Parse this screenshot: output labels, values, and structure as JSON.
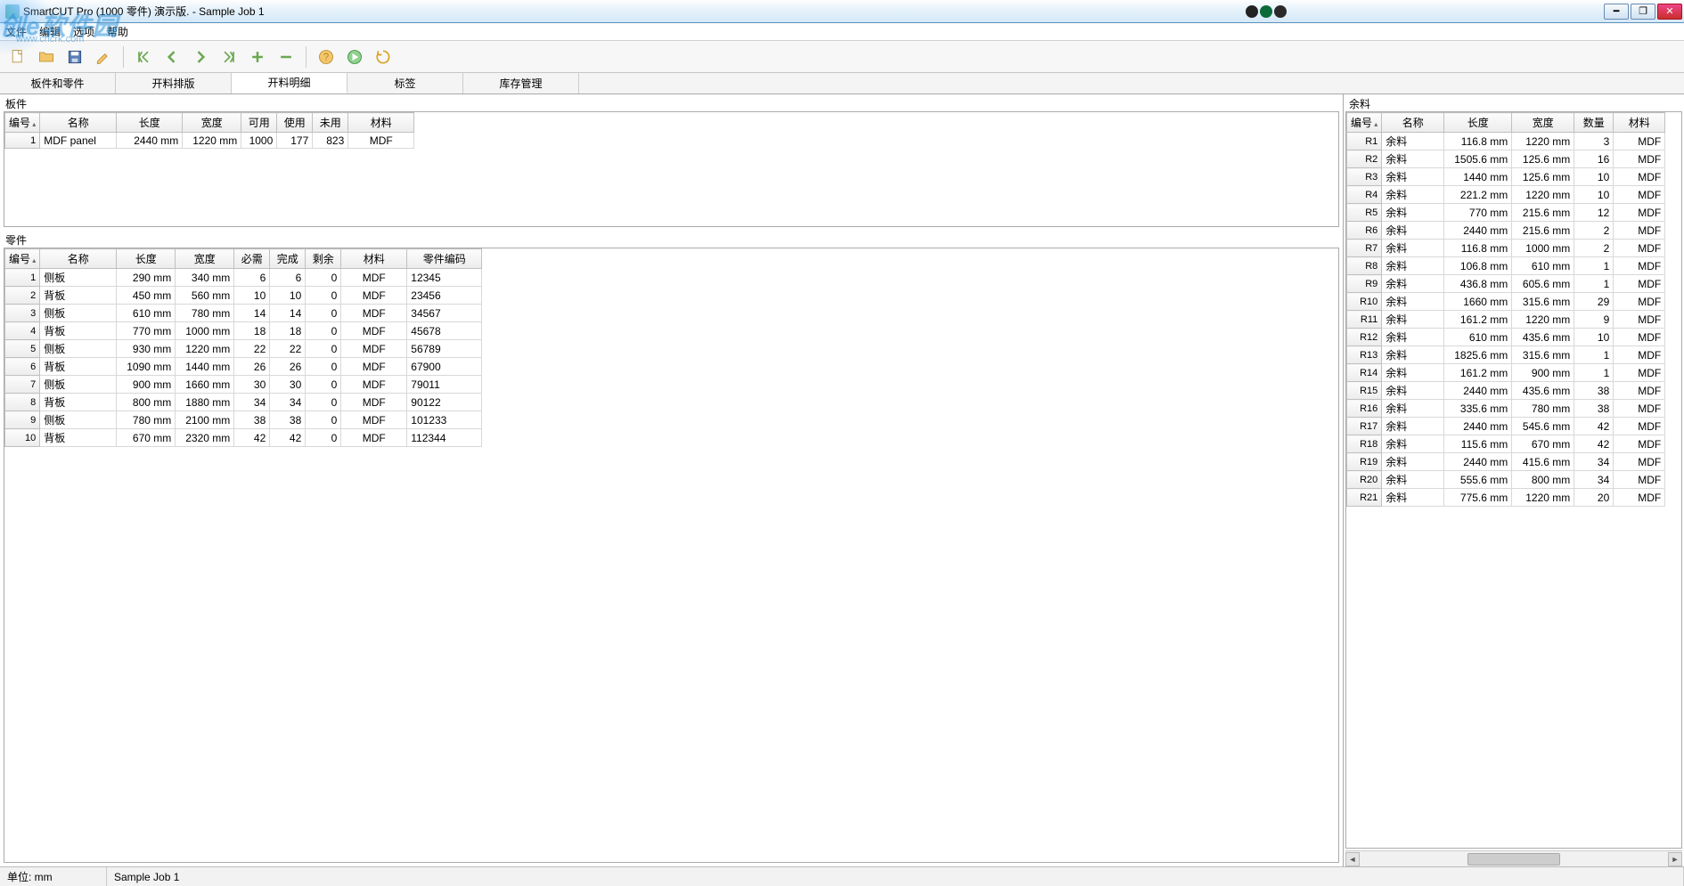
{
  "window": {
    "title": "SmartCUT Pro (1000 零件) 演示版. - Sample Job 1"
  },
  "menu": {
    "file": "文件",
    "edit": "编辑",
    "options": "选项",
    "help": "帮助"
  },
  "tabs": {
    "t0": "板件和零件",
    "t1": "开料排版",
    "t2": "开料明细",
    "t3": "标签",
    "t4": "库存管理"
  },
  "sections": {
    "panels": "板件",
    "parts": "零件",
    "offcuts": "余料"
  },
  "panels_headers": {
    "id": "编号",
    "name": "名称",
    "length": "长度",
    "width": "宽度",
    "avail": "可用",
    "used": "使用",
    "unused": "未用",
    "material": "材料"
  },
  "panels_rows": [
    {
      "id": "1",
      "name": "MDF panel",
      "length": "2440 mm",
      "width": "1220 mm",
      "avail": "1000",
      "used": "177",
      "unused": "823",
      "material": "MDF"
    }
  ],
  "parts_headers": {
    "id": "编号",
    "name": "名称",
    "length": "长度",
    "width": "宽度",
    "need": "必需",
    "done": "完成",
    "remain": "剩余",
    "material": "材料",
    "code": "零件编码"
  },
  "parts_rows": [
    {
      "id": "1",
      "name": "侧板",
      "length": "290 mm",
      "width": "340 mm",
      "need": "6",
      "done": "6",
      "remain": "0",
      "material": "MDF",
      "code": "12345"
    },
    {
      "id": "2",
      "name": "背板",
      "length": "450 mm",
      "width": "560 mm",
      "need": "10",
      "done": "10",
      "remain": "0",
      "material": "MDF",
      "code": "23456"
    },
    {
      "id": "3",
      "name": "侧板",
      "length": "610 mm",
      "width": "780 mm",
      "need": "14",
      "done": "14",
      "remain": "0",
      "material": "MDF",
      "code": "34567"
    },
    {
      "id": "4",
      "name": "背板",
      "length": "770 mm",
      "width": "1000 mm",
      "need": "18",
      "done": "18",
      "remain": "0",
      "material": "MDF",
      "code": "45678"
    },
    {
      "id": "5",
      "name": "侧板",
      "length": "930 mm",
      "width": "1220 mm",
      "need": "22",
      "done": "22",
      "remain": "0",
      "material": "MDF",
      "code": "56789"
    },
    {
      "id": "6",
      "name": "背板",
      "length": "1090 mm",
      "width": "1440 mm",
      "need": "26",
      "done": "26",
      "remain": "0",
      "material": "MDF",
      "code": "67900"
    },
    {
      "id": "7",
      "name": "侧板",
      "length": "900 mm",
      "width": "1660 mm",
      "need": "30",
      "done": "30",
      "remain": "0",
      "material": "MDF",
      "code": "79011"
    },
    {
      "id": "8",
      "name": "背板",
      "length": "800 mm",
      "width": "1880 mm",
      "need": "34",
      "done": "34",
      "remain": "0",
      "material": "MDF",
      "code": "90122"
    },
    {
      "id": "9",
      "name": "侧板",
      "length": "780 mm",
      "width": "2100 mm",
      "need": "38",
      "done": "38",
      "remain": "0",
      "material": "MDF",
      "code": "101233"
    },
    {
      "id": "10",
      "name": "背板",
      "length": "670 mm",
      "width": "2320 mm",
      "need": "42",
      "done": "42",
      "remain": "0",
      "material": "MDF",
      "code": "112344"
    }
  ],
  "offcuts_headers": {
    "id": "编号",
    "name": "名称",
    "length": "长度",
    "width": "宽度",
    "qty": "数量",
    "material": "材料"
  },
  "offcuts_rows": [
    {
      "id": "R1",
      "name": "余料",
      "length": "116.8 mm",
      "width": "1220 mm",
      "qty": "3",
      "material": "MDF"
    },
    {
      "id": "R2",
      "name": "余料",
      "length": "1505.6 mm",
      "width": "125.6 mm",
      "qty": "16",
      "material": "MDF"
    },
    {
      "id": "R3",
      "name": "余料",
      "length": "1440 mm",
      "width": "125.6 mm",
      "qty": "10",
      "material": "MDF"
    },
    {
      "id": "R4",
      "name": "余料",
      "length": "221.2 mm",
      "width": "1220 mm",
      "qty": "10",
      "material": "MDF"
    },
    {
      "id": "R5",
      "name": "余料",
      "length": "770 mm",
      "width": "215.6 mm",
      "qty": "12",
      "material": "MDF"
    },
    {
      "id": "R6",
      "name": "余料",
      "length": "2440 mm",
      "width": "215.6 mm",
      "qty": "2",
      "material": "MDF"
    },
    {
      "id": "R7",
      "name": "余料",
      "length": "116.8 mm",
      "width": "1000 mm",
      "qty": "2",
      "material": "MDF"
    },
    {
      "id": "R8",
      "name": "余料",
      "length": "106.8 mm",
      "width": "610 mm",
      "qty": "1",
      "material": "MDF"
    },
    {
      "id": "R9",
      "name": "余料",
      "length": "436.8 mm",
      "width": "605.6 mm",
      "qty": "1",
      "material": "MDF"
    },
    {
      "id": "R10",
      "name": "余料",
      "length": "1660 mm",
      "width": "315.6 mm",
      "qty": "29",
      "material": "MDF"
    },
    {
      "id": "R11",
      "name": "余料",
      "length": "161.2 mm",
      "width": "1220 mm",
      "qty": "9",
      "material": "MDF"
    },
    {
      "id": "R12",
      "name": "余料",
      "length": "610 mm",
      "width": "435.6 mm",
      "qty": "10",
      "material": "MDF"
    },
    {
      "id": "R13",
      "name": "余料",
      "length": "1825.6 mm",
      "width": "315.6 mm",
      "qty": "1",
      "material": "MDF"
    },
    {
      "id": "R14",
      "name": "余料",
      "length": "161.2 mm",
      "width": "900 mm",
      "qty": "1",
      "material": "MDF"
    },
    {
      "id": "R15",
      "name": "余料",
      "length": "2440 mm",
      "width": "435.6 mm",
      "qty": "38",
      "material": "MDF"
    },
    {
      "id": "R16",
      "name": "余料",
      "length": "335.6 mm",
      "width": "780 mm",
      "qty": "38",
      "material": "MDF"
    },
    {
      "id": "R17",
      "name": "余料",
      "length": "2440 mm",
      "width": "545.6 mm",
      "qty": "42",
      "material": "MDF"
    },
    {
      "id": "R18",
      "name": "余料",
      "length": "115.6 mm",
      "width": "670 mm",
      "qty": "42",
      "material": "MDF"
    },
    {
      "id": "R19",
      "name": "余料",
      "length": "2440 mm",
      "width": "415.6 mm",
      "qty": "34",
      "material": "MDF"
    },
    {
      "id": "R20",
      "name": "余料",
      "length": "555.6 mm",
      "width": "800 mm",
      "qty": "34",
      "material": "MDF"
    },
    {
      "id": "R21",
      "name": "余料",
      "length": "775.6 mm",
      "width": "1220 mm",
      "qty": "20",
      "material": "MDF"
    }
  ],
  "status": {
    "units": "单位: mm",
    "job": "Sample Job 1"
  },
  "watermark": {
    "text": "创e软件园",
    "url": "www.cncrk.com"
  }
}
